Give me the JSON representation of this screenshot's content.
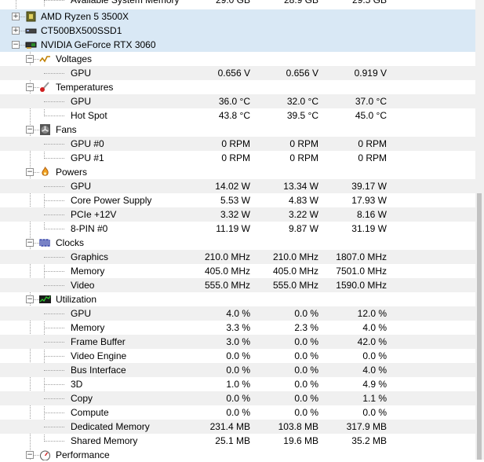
{
  "top_partial": {
    "label": "Available System Memory",
    "v1": "29.0 GB",
    "v2": "28.9 GB",
    "v3": "29.5 GB"
  },
  "devices": {
    "cpu": "AMD Ryzen 5 3500X",
    "ssd": "CT500BX500SSD1",
    "gpu": "NVIDIA GeForce RTX 3060"
  },
  "voltages": {
    "label": "Voltages",
    "rows": [
      {
        "label": "GPU",
        "v1": "0.656 V",
        "v2": "0.656 V",
        "v3": "0.919 V"
      }
    ]
  },
  "temperatures": {
    "label": "Temperatures",
    "rows": [
      {
        "label": "GPU",
        "v1": "36.0 °C",
        "v2": "32.0 °C",
        "v3": "37.0 °C"
      },
      {
        "label": "Hot Spot",
        "v1": "43.8 °C",
        "v2": "39.5 °C",
        "v3": "45.0 °C"
      }
    ]
  },
  "fans": {
    "label": "Fans",
    "rows": [
      {
        "label": "GPU #0",
        "v1": "0 RPM",
        "v2": "0 RPM",
        "v3": "0 RPM"
      },
      {
        "label": "GPU #1",
        "v1": "0 RPM",
        "v2": "0 RPM",
        "v3": "0 RPM"
      }
    ]
  },
  "powers": {
    "label": "Powers",
    "rows": [
      {
        "label": "GPU",
        "v1": "14.02 W",
        "v2": "13.34 W",
        "v3": "39.17 W"
      },
      {
        "label": "Core Power Supply",
        "v1": "5.53 W",
        "v2": "4.83 W",
        "v3": "17.93 W"
      },
      {
        "label": "PCIe +12V",
        "v1": "3.32 W",
        "v2": "3.22 W",
        "v3": "8.16 W"
      },
      {
        "label": "8-PIN #0",
        "v1": "11.19 W",
        "v2": "9.87 W",
        "v3": "31.19 W"
      }
    ]
  },
  "clocks": {
    "label": "Clocks",
    "rows": [
      {
        "label": "Graphics",
        "v1": "210.0 MHz",
        "v2": "210.0 MHz",
        "v3": "1807.0 MHz"
      },
      {
        "label": "Memory",
        "v1": "405.0 MHz",
        "v2": "405.0 MHz",
        "v3": "7501.0 MHz"
      },
      {
        "label": "Video",
        "v1": "555.0 MHz",
        "v2": "555.0 MHz",
        "v3": "1590.0 MHz"
      }
    ]
  },
  "utilization": {
    "label": "Utilization",
    "rows": [
      {
        "label": "GPU",
        "v1": "4.0 %",
        "v2": "0.0 %",
        "v3": "12.0 %"
      },
      {
        "label": "Memory",
        "v1": "3.3 %",
        "v2": "2.3 %",
        "v3": "4.0 %"
      },
      {
        "label": "Frame Buffer",
        "v1": "3.0 %",
        "v2": "0.0 %",
        "v3": "42.0 %"
      },
      {
        "label": "Video Engine",
        "v1": "0.0 %",
        "v2": "0.0 %",
        "v3": "0.0 %"
      },
      {
        "label": "Bus Interface",
        "v1": "0.0 %",
        "v2": "0.0 %",
        "v3": "4.0 %"
      },
      {
        "label": "3D",
        "v1": "1.0 %",
        "v2": "0.0 %",
        "v3": "4.9 %"
      },
      {
        "label": "Copy",
        "v1": "0.0 %",
        "v2": "0.0 %",
        "v3": "1.1 %"
      },
      {
        "label": "Compute",
        "v1": "0.0 %",
        "v2": "0.0 %",
        "v3": "0.0 %"
      },
      {
        "label": "Dedicated Memory",
        "v1": "231.4 MB",
        "v2": "103.8 MB",
        "v3": "317.9 MB"
      },
      {
        "label": "Shared Memory",
        "v1": "25.1 MB",
        "v2": "19.6 MB",
        "v3": "35.2 MB"
      }
    ]
  },
  "performance": {
    "label": "Performance"
  },
  "icons": {
    "cpu": "cpu-chip-icon",
    "ssd": "drive-icon",
    "gpu": "graphics-card-icon",
    "voltages": "voltage-wave-icon",
    "temperatures": "thermometer-icon",
    "fans": "fan-icon",
    "powers": "flame-icon",
    "clocks": "clock-signal-icon",
    "utilization": "utilization-chart-icon",
    "performance": "gauge-icon"
  },
  "colors": {
    "selected_row": "#d9e8f5",
    "alt_row": "#f0f0f0",
    "tree_line": "#a0a0a0"
  }
}
